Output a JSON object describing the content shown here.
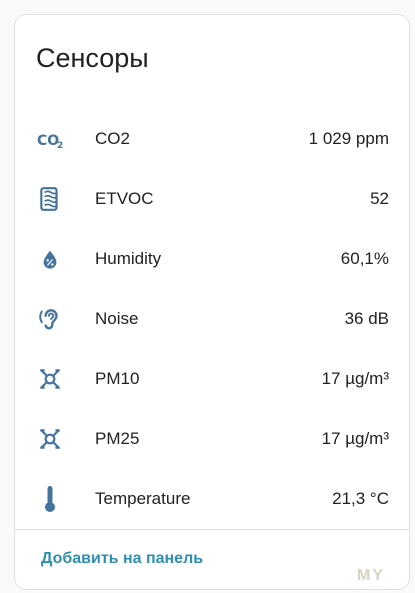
{
  "card": {
    "title": "Сенсоры",
    "accent_color": "#44739e",
    "rows": [
      {
        "icon": "co2-icon",
        "name": "CO2",
        "value": "1 029 ppm"
      },
      {
        "icon": "air-filter-icon",
        "name": "ETVOC",
        "value": "52"
      },
      {
        "icon": "water-percent-icon",
        "name": "Humidity",
        "value": "60,1%"
      },
      {
        "icon": "ear-hearing-icon",
        "name": "Noise",
        "value": "36 dB"
      },
      {
        "icon": "molecule-icon",
        "name": "PM10",
        "value": "17 µg/m³"
      },
      {
        "icon": "molecule-icon",
        "name": "PM25",
        "value": "17 µg/m³"
      },
      {
        "icon": "thermometer-icon",
        "name": "Temperature",
        "value": "21,3 °C"
      }
    ],
    "add_to_panel_label": "Добавить на панель",
    "link_color": "#2e8fb0"
  },
  "watermark": "MY"
}
